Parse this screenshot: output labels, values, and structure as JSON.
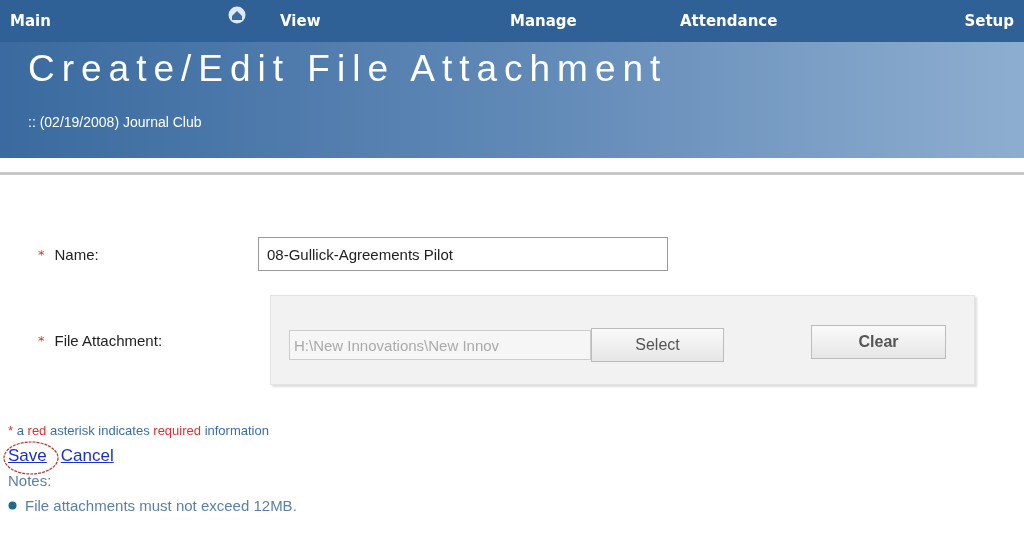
{
  "nav": [
    {
      "label": "Main",
      "kind": "text"
    },
    {
      "kind": "home"
    },
    {
      "label": "View",
      "kind": "text"
    },
    {
      "label": "Manage",
      "kind": "text"
    },
    {
      "label": "Attendance",
      "kind": "text"
    },
    {
      "label": "Setup",
      "kind": "text"
    }
  ],
  "banner": {
    "title": "Create/Edit File Attachment",
    "subtitle": ":: (02/19/2008) Journal Club"
  },
  "form": {
    "name": {
      "marker": "*",
      "label": "Name:",
      "value": "08-Gullick-Agreements Pilot"
    },
    "file": {
      "marker": "*",
      "label": "File Attachment:",
      "path": "H:\\New Innovations\\New Innov",
      "select": "Select",
      "clear": "Clear"
    }
  },
  "required_note": {
    "marker": "*",
    "parts": [
      {
        "text": "a",
        "kind": "plain"
      },
      {
        "text": "red",
        "kind": "red"
      },
      {
        "text": "asterisk indicates",
        "kind": "plain"
      },
      {
        "text": "required",
        "kind": "red"
      },
      {
        "text": "information",
        "kind": "plain"
      }
    ]
  },
  "links": [
    {
      "label": "Save",
      "circled": true
    },
    {
      "label": "Cancel",
      "circled": false
    }
  ],
  "notes": {
    "title": "Notes:",
    "items": [
      "File attachments must not exceed 12MB."
    ]
  }
}
